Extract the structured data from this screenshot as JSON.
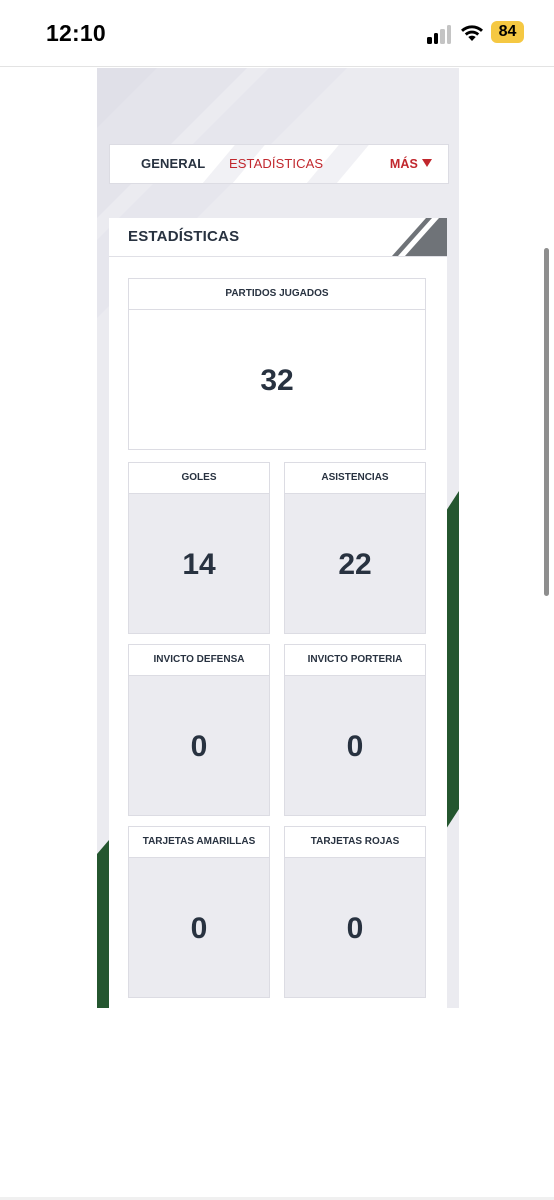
{
  "status_bar": {
    "time": "12:10",
    "battery_level": "84",
    "battery_color": "#f5c842",
    "icons": [
      "signal-icon",
      "wifi-icon",
      "battery-icon"
    ]
  },
  "nav_tabs": {
    "general": "GENERAL",
    "estadisticas": "ESTADÍSTICAS",
    "mas": "MÁS",
    "active_tab": "ESTADÍSTICAS"
  },
  "section": {
    "title": "ESTADÍSTICAS"
  },
  "stats": [
    {
      "label": "PARTIDOS JUGADOS",
      "value": "32"
    },
    {
      "label": "GOLES",
      "value": "14"
    },
    {
      "label": "ASISTENCIAS",
      "value": "22"
    },
    {
      "label": "INVICTO DEFENSA",
      "value": "0"
    },
    {
      "label": "INVICTO PORTERIA",
      "value": "0"
    },
    {
      "label": "TARJETAS AMARILLAS",
      "value": "0"
    },
    {
      "label": "TARJETAS ROJAS",
      "value": "0"
    }
  ],
  "colors": {
    "accent_red": "#c1272d",
    "text_dark": "#283240",
    "green_stripe": "#24562f",
    "panel_grey": "#ebebf0"
  }
}
